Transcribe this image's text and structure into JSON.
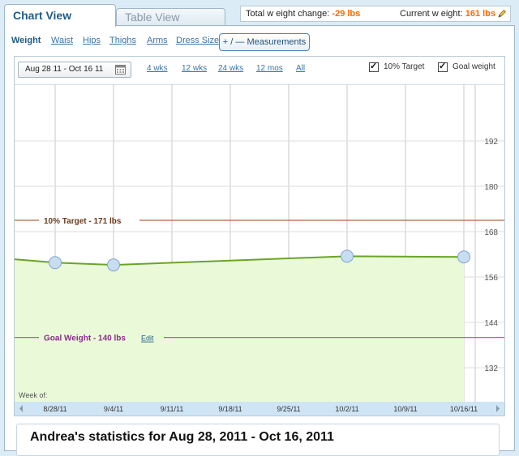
{
  "tabs": [
    {
      "label": "Chart View",
      "active": true
    },
    {
      "label": "Table View",
      "active": false
    }
  ],
  "summary": {
    "total_label": "Total w eight change:",
    "total_value": "-29  lbs",
    "current_label": "Current w eight:",
    "current_value": "161  lbs"
  },
  "measurements": {
    "items": [
      "Weight",
      "Waist",
      "Hips",
      "Thighs",
      "Arms",
      "Dress Size"
    ],
    "selected": "Weight",
    "button_label": "+ / —  Measurements"
  },
  "controls": {
    "date_range": "Aug 28 11 - Oct 16 11",
    "ranges": [
      "4 wks",
      "12 wks",
      "24 wks",
      "12 mos",
      "All"
    ],
    "checkboxes": [
      {
        "label": "10% Target",
        "checked": true
      },
      {
        "label": "Goal weight",
        "checked": true
      }
    ]
  },
  "chart_data": {
    "type": "area",
    "x_prefix": "Week of:",
    "x": [
      "8/28/11",
      "9/4/11",
      "9/11/11",
      "9/18/11",
      "9/25/11",
      "10/2/11",
      "10/9/11",
      "10/16/11"
    ],
    "series": [
      {
        "name": "Weight",
        "points": [
          {
            "x": "8/28/11",
            "y": 159.8
          },
          {
            "x": "9/4/11",
            "y": 159.2
          },
          {
            "x": "10/2/11",
            "y": 161.5
          },
          {
            "x": "10/16/11",
            "y": 161.3
          }
        ],
        "color": "#6aa42a",
        "fill": "#eafad8",
        "marker_fill": "#c8dcf2"
      }
    ],
    "y_ticks": [
      192,
      180,
      168,
      156,
      144,
      132
    ],
    "ylim": [
      123,
      207
    ],
    "grid": true,
    "reference_lines": [
      {
        "label": "10% Target - 171 lbs",
        "value": 171,
        "color": "#b3663c",
        "text_color": "#6b3a1c"
      },
      {
        "label": "Goal Weight - 140 lbs",
        "value": 140,
        "color": "#a74ca7",
        "text_color": "#8a2e8a",
        "edit_label": "Edit"
      }
    ]
  },
  "stats": {
    "title": "Andrea's statistics for Aug 28, 2011 - Oct 16, 2011"
  },
  "colors": {
    "accent": "#1f5c87",
    "highlight": "#ff6a00",
    "background": "#dcecf6"
  }
}
